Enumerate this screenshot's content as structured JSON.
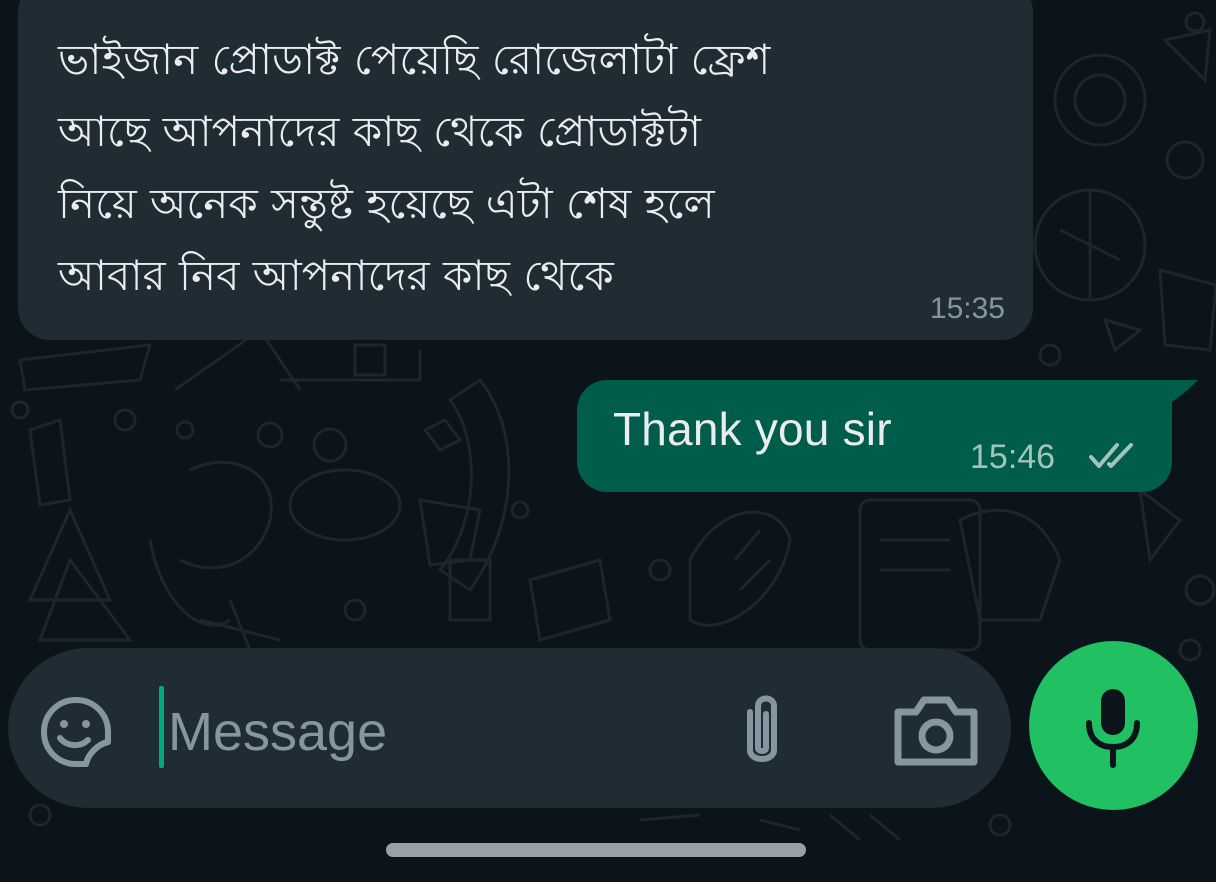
{
  "messages": {
    "incoming": {
      "text": "ভাইজান প্রোডাক্ট পেয়েছি রোজেলাটা ফ্রেশ\nআছে আপনাদের কাছ থেকে প্রোডাক্টটা\nনিয়ে অনেক সন্তুষ্ট হয়েছে এটা শেষ হলে\nআবার নিব আপনাদের কাছ থেকে",
      "time": "15:35"
    },
    "outgoing": {
      "text": "Thank you sir",
      "time": "15:46",
      "status_icon": "double-check-read-icon"
    }
  },
  "composer": {
    "placeholder": "Message",
    "emoji_icon": "sticker-emoji-icon",
    "attach_icon": "paperclip-icon",
    "camera_icon": "camera-icon",
    "mic_icon": "microphone-icon"
  },
  "colors": {
    "background": "#0b141a",
    "incoming_bubble": "#202c33",
    "outgoing_bubble": "#005c4b",
    "accent": "#21c063",
    "text_primary": "#e9edef",
    "text_secondary": "#8696a0"
  }
}
